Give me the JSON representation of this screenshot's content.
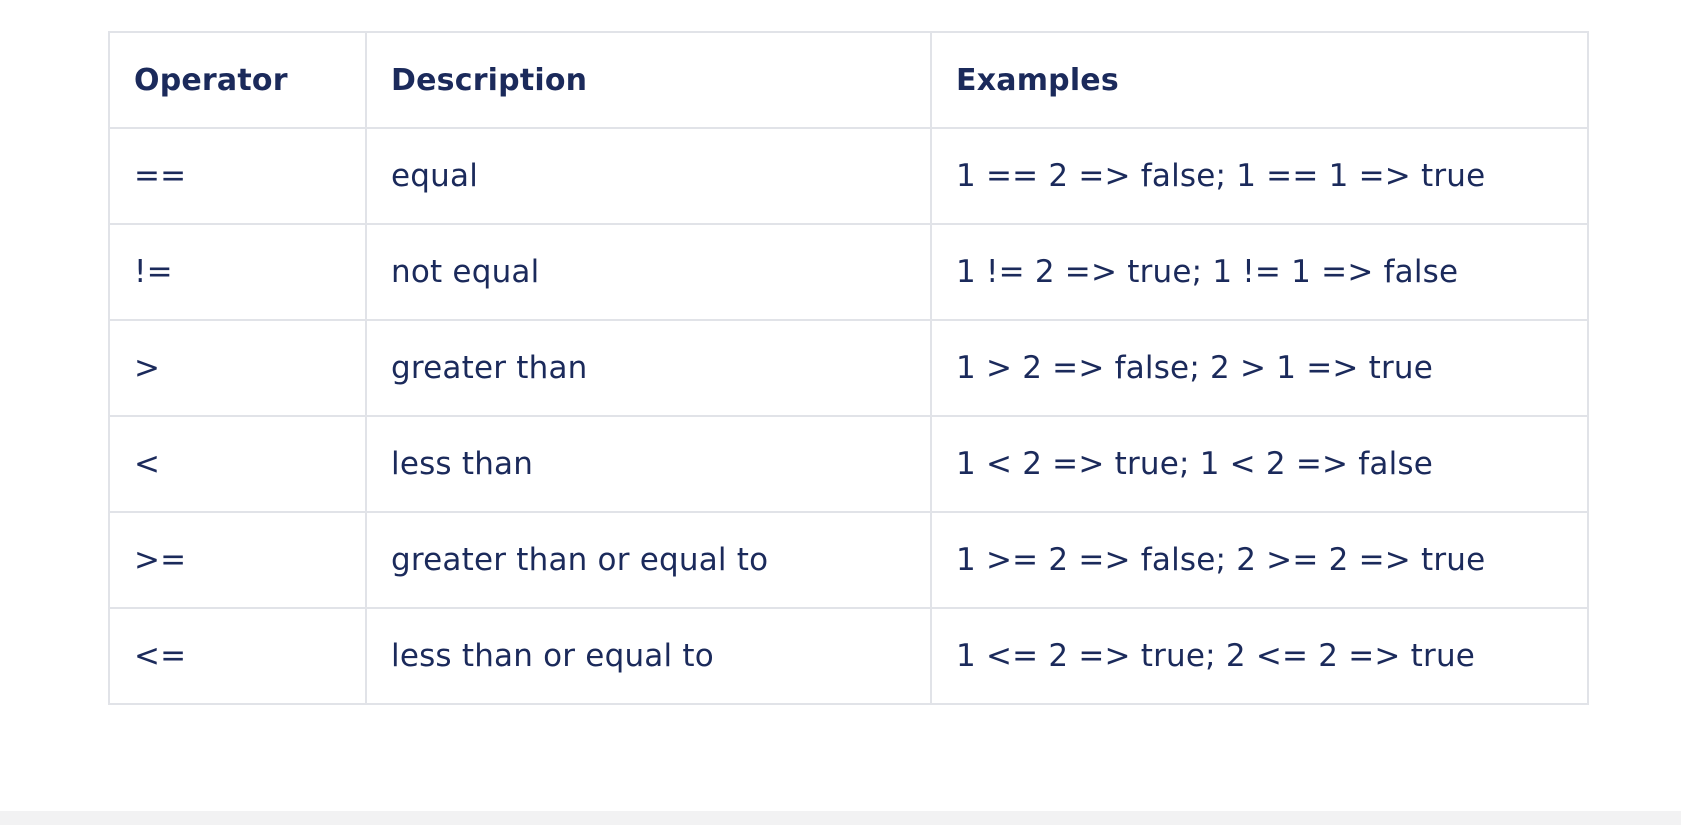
{
  "table": {
    "headers": [
      "Operator",
      "Description",
      "Examples"
    ],
    "rows": [
      [
        "==",
        "equal",
        "1 == 2 => false; 1 == 1 => true"
      ],
      [
        "!=",
        "not equal",
        "1 != 2 => true; 1 != 1 => false"
      ],
      [
        ">",
        "greater than",
        "1 > 2 => false; 2 > 1 => true"
      ],
      [
        "<",
        "less than",
        "1 < 2 => true; 1 < 2 => false"
      ],
      [
        ">=",
        "greater than or equal to",
        "1 >= 2 => false; 2 >= 2 => true"
      ],
      [
        "<=",
        "less than or equal to",
        "1 <= 2 => true; 2 <= 2 => true"
      ]
    ]
  },
  "colors": {
    "text": "#1b2a5b",
    "border": "#e1e3e8",
    "footer_band": "#f2f2f3"
  }
}
